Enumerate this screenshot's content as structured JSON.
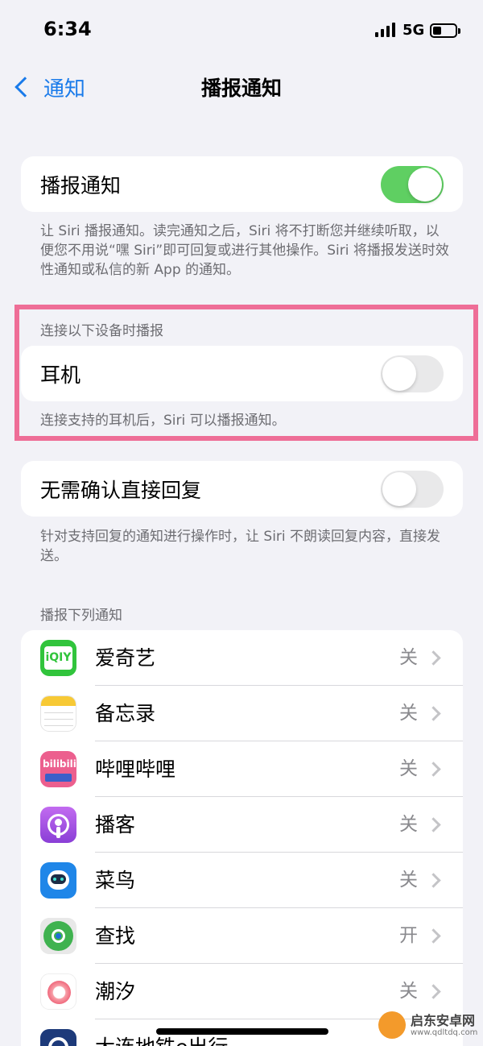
{
  "status_bar": {
    "time": "6:34",
    "network": "5G"
  },
  "nav": {
    "back_label": "通知",
    "title": "播报通知"
  },
  "announce": {
    "label": "播报通知",
    "toggle_on": true,
    "footnote": "让 Siri 播报通知。读完通知之后，Siri 将不打断您并继续听取，以便您不用说“嘿 Siri”即可回复或进行其他操作。Siri 将播报发送时效性通知或私信的新 App 的通知。"
  },
  "devices": {
    "header": "连接以下设备时播报",
    "headphones_label": "耳机",
    "toggle_on": false,
    "footnote": "连接支持的耳机后，Siri 可以播报通知。"
  },
  "reply": {
    "label": "无需确认直接回复",
    "toggle_on": false,
    "footnote": "针对支持回复的通知进行操作时，让 Siri 不朗读回复内容，直接发送。"
  },
  "apps_header": "播报下列通知",
  "apps": [
    {
      "name": "爱奇艺",
      "status": "关",
      "icon": "iqiyi-icon",
      "color": "#31c43c"
    },
    {
      "name": "备忘录",
      "status": "关",
      "icon": "notes-icon",
      "color": "#f7c935"
    },
    {
      "name": "哔哩哔哩",
      "status": "关",
      "icon": "bilibili-icon",
      "color": "#ec5f8e"
    },
    {
      "name": "播客",
      "status": "关",
      "icon": "podcasts-icon",
      "color": "#9a4ed9"
    },
    {
      "name": "菜鸟",
      "status": "关",
      "icon": "cainiao-icon",
      "color": "#1f86e8"
    },
    {
      "name": "查找",
      "status": "开",
      "icon": "findmy-icon",
      "color": "#3fb24f"
    },
    {
      "name": "潮汐",
      "status": "关",
      "icon": "tide-icon",
      "color": "#f37a8a"
    },
    {
      "name": "大连地铁e出行",
      "status": "",
      "icon": "metro-icon",
      "color": "#1d3a7a"
    }
  ],
  "watermark": {
    "text": "启东安卓网",
    "url": "www.qdltdq.com"
  }
}
